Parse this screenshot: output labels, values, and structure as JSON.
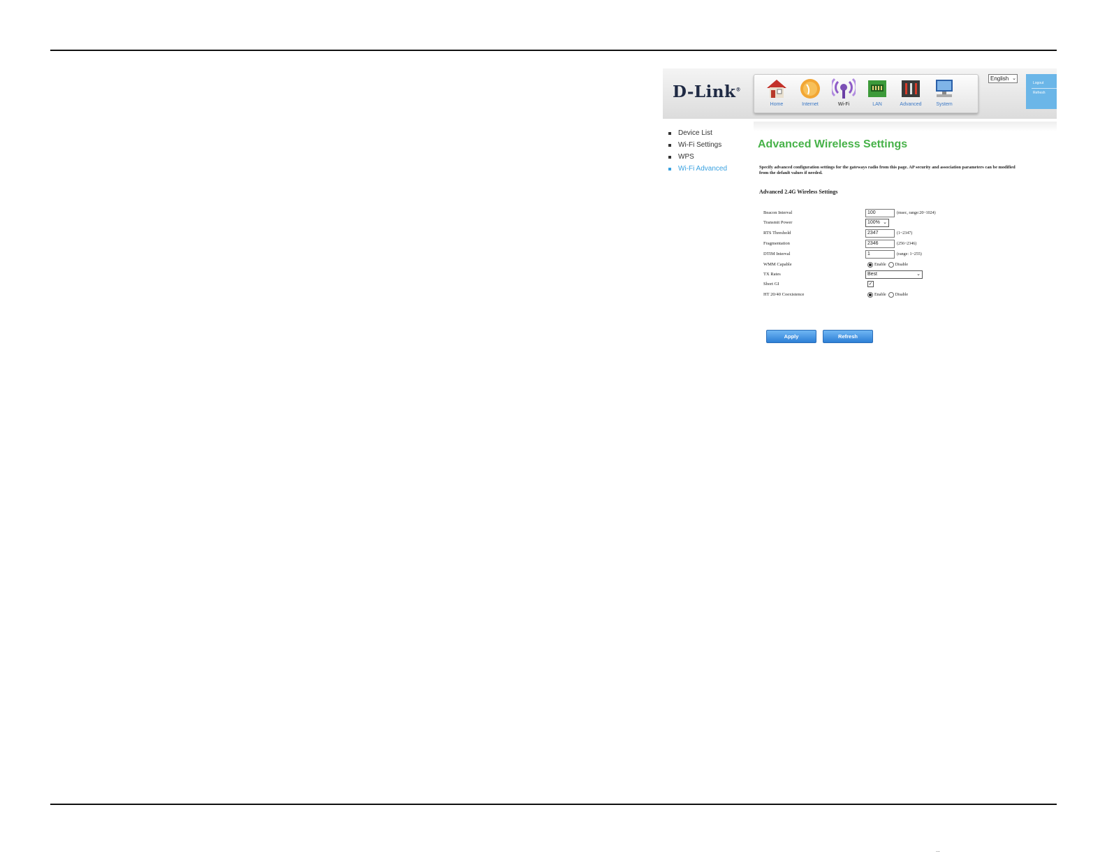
{
  "header": {
    "logo": "D-Link",
    "logo_mark": "®",
    "language": "English",
    "side_links": [
      "Logout",
      "Refresh"
    ],
    "nav": [
      {
        "label": "Home",
        "icon": "home-icon"
      },
      {
        "label": "Internet",
        "icon": "globe-icon"
      },
      {
        "label": "Wi-Fi",
        "icon": "wifi-icon"
      },
      {
        "label": "LAN",
        "icon": "lan-icon"
      },
      {
        "label": "Advanced",
        "icon": "tools-icon"
      },
      {
        "label": "System",
        "icon": "computer-icon"
      }
    ],
    "active_nav": "Wi-Fi"
  },
  "sidebar": {
    "items": [
      {
        "label": "Device List"
      },
      {
        "label": "Wi-Fi Settings"
      },
      {
        "label": "WPS"
      },
      {
        "label": "Wi-Fi Advanced"
      }
    ],
    "active": "Wi-Fi Advanced"
  },
  "main": {
    "title": "Advanced Wireless Settings",
    "intro": "Specify advanced configuration settings for the gateways radio from this page. AP security and association parameters can be modified from the default values if needed.",
    "section_title": "Advanced 2.4G Wireless Settings",
    "fields": {
      "beacon_interval": {
        "label": "Beacon Interval",
        "value": "100",
        "hint": "(msec, range:20~1024)"
      },
      "transmit_power": {
        "label": "Transmit Power",
        "value": "100%"
      },
      "rts_threshold": {
        "label": "RTS Threshold",
        "value": "2347",
        "hint": "(1~2347)"
      },
      "fragmentation": {
        "label": "Fragmentation",
        "value": "2346",
        "hint": "(256~2346)"
      },
      "dtim_interval": {
        "label": "DTIM Interval",
        "value": "1",
        "hint": "(range: 1~255)"
      },
      "wmm_capable": {
        "label": "WMM Capable",
        "enable": "Enable",
        "disable": "Disable",
        "selected": "Enable"
      },
      "tx_rates": {
        "label": "TX Rates",
        "value": "Best"
      },
      "short_gi": {
        "label": "Short GI",
        "checked": true
      },
      "ht_coexistence": {
        "label": "HT 20/40 Coexistence",
        "enable": "Enable",
        "disable": "Disable",
        "selected": "Enable"
      }
    },
    "buttons": {
      "apply": "Apply",
      "refresh": "Refresh"
    }
  },
  "colors": {
    "title_green": "#47b249",
    "active_link_blue": "#39a1e0",
    "button_blue": "#2d7fd6",
    "side_tab_blue": "#6bb6e8"
  },
  "footer": {
    "text": "..."
  }
}
